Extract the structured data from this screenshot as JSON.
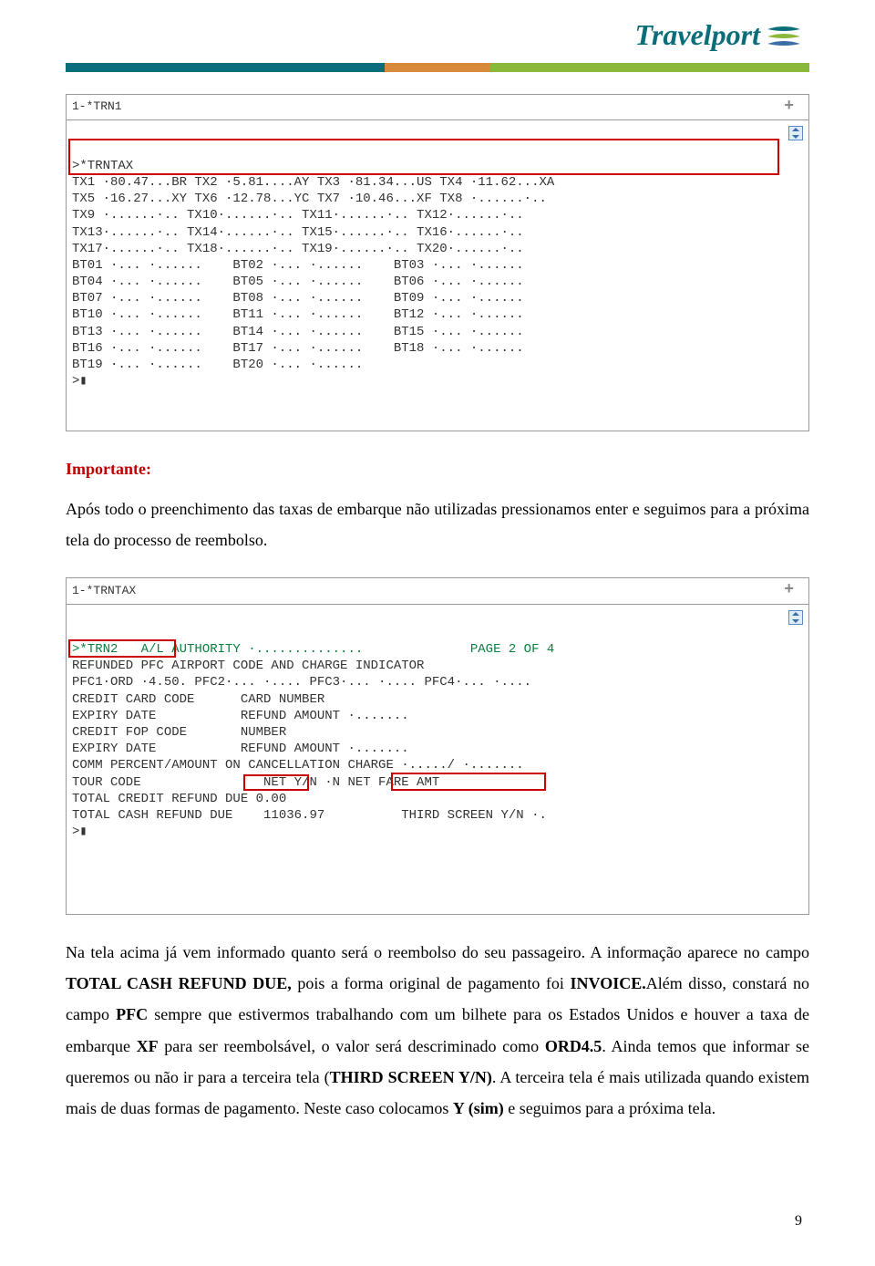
{
  "logo_text": "Travelport",
  "terminal1": {
    "header": "1-*TRN1",
    "lines": [
      ">*TRNTAX",
      "TX1 ·80.47...BR TX2 ·5.81....AY TX3 ·81.34...US TX4 ·11.62...XA",
      "TX5 ·16.27...XY TX6 ·12.78...YC TX7 ·10.46...XF TX8 ·......·..",
      "TX9 ·......·.. TX10·......·.. TX11·......·.. TX12·......·..",
      "TX13·......·.. TX14·......·.. TX15·......·.. TX16·......·..",
      "TX17·......·.. TX18·......·.. TX19·......·.. TX20·......·..",
      "BT01 ·... ·......    BT02 ·... ·......    BT03 ·... ·......",
      "BT04 ·... ·......    BT05 ·... ·......    BT06 ·... ·......",
      "BT07 ·... ·......    BT08 ·... ·......    BT09 ·... ·......",
      "BT10 ·... ·......    BT11 ·... ·......    BT12 ·... ·......",
      "BT13 ·... ·......    BT14 ·... ·......    BT15 ·... ·......",
      "BT16 ·... ·......    BT17 ·... ·......    BT18 ·... ·......",
      "BT19 ·... ·......    BT20 ·... ·......",
      ">▮"
    ]
  },
  "para1": {
    "important": "Importante:",
    "text": "Após todo o preenchimento das taxas de embarque não utilizadas pressionamos enter e seguimos para a próxima tela do processo de reembolso."
  },
  "terminal2": {
    "header": "1-*TRNTAX",
    "lines": [
      ">*TRN2   A/L AUTHORITY ·..............              PAGE 2 OF 4",
      "REFUNDED PFC AIRPORT CODE AND CHARGE INDICATOR",
      "PFC1·ORD ·4.50. PFC2·... ·.... PFC3·... ·.... PFC4·... ·....",
      "CREDIT CARD CODE      CARD NUMBER",
      "EXPIRY DATE           REFUND AMOUNT ·.......",
      "CREDIT FOP CODE       NUMBER",
      "EXPIRY DATE           REFUND AMOUNT ·.......",
      "COMM PERCENT/AMOUNT ON CANCELLATION CHARGE ·...../ ·.......",
      "TOUR CODE                NET Y/N ·N NET FARE AMT",
      "TOTAL CREDIT REFUND DUE 0.00",
      "TOTAL CASH REFUND DUE    11036.97          THIRD SCREEN Y/N ·.",
      ">▮"
    ]
  },
  "para2": {
    "t1": "Na tela acima já vem informado quanto será o reembolso do seu passageiro. A informação aparece no campo ",
    "b1": "TOTAL CASH REFUND DUE,",
    "t2": " pois a forma original de pagamento foi ",
    "b2": "INVOICE.",
    "t3": "Além disso, constará no campo ",
    "b3": "PFC",
    "t4": " sempre que estivermos trabalhando com um bilhete para os Estados Unidos e houver a taxa de embarque ",
    "b4": "XF",
    "t5": " para ser reembolsável, o valor será descriminado como ",
    "b5": "ORD4.5",
    "t6": ". Ainda temos que informar se queremos ou não ir para a terceira tela (",
    "b6": "THIRD SCREEN Y/N)",
    "t7": ". A terceira tela é mais utilizada quando existem mais de duas formas de pagamento. Neste caso colocamos ",
    "b7": "Y (sim)",
    "t8": " e seguimos para a próxima tela."
  },
  "page_number": "9"
}
